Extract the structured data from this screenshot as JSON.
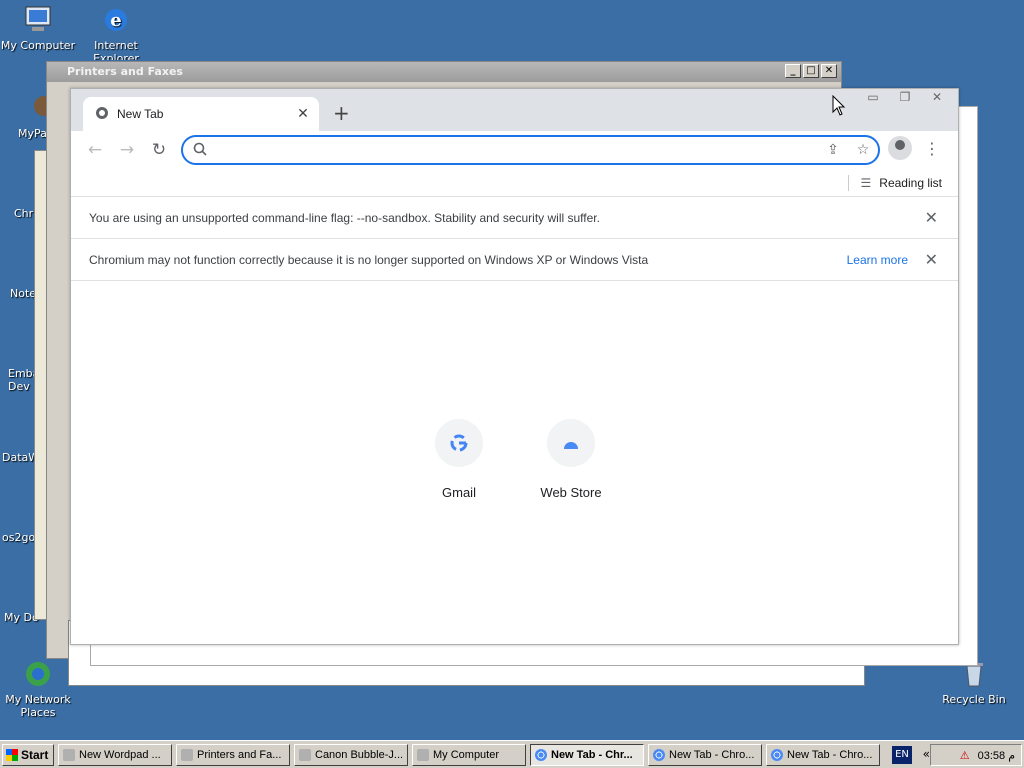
{
  "desktop": {
    "icons": [
      {
        "label": "My Computer"
      },
      {
        "label": "Internet Explorer"
      },
      {
        "label": "MyPal"
      },
      {
        "label": "Chr"
      },
      {
        "label": "Note"
      },
      {
        "label": "Emba Dev"
      },
      {
        "label": "DataW"
      },
      {
        "label": "os2go"
      },
      {
        "label": "My Do"
      },
      {
        "label": "My Network Places"
      },
      {
        "label": "Recycle Bin"
      }
    ]
  },
  "printers_window": {
    "title": "Printers and Faxes"
  },
  "browser": {
    "tab_title": "New Tab",
    "reading_list": "Reading list",
    "omnibox_placeholder": "",
    "infobars": [
      {
        "text": "You are using an unsupported command-line flag: --no-sandbox. Stability and security will suffer."
      },
      {
        "text": "Chromium may not function correctly because it is no longer supported on Windows XP or Windows Vista",
        "link": "Learn more"
      }
    ],
    "shortcuts": [
      {
        "label": "Gmail"
      },
      {
        "label": "Web Store"
      }
    ],
    "colors": {
      "accent": "#1a73e8",
      "tabstrip": "#dee1e6"
    }
  },
  "taskbar": {
    "start": "Start",
    "buttons": [
      {
        "label": "New Wordpad ..."
      },
      {
        "label": "Printers and Fa..."
      },
      {
        "label": "Canon Bubble-J..."
      },
      {
        "label": "My Computer"
      },
      {
        "label": "New Tab - Chr..."
      },
      {
        "label": "New Tab - Chro..."
      },
      {
        "label": "New Tab - Chro..."
      }
    ],
    "lang": "EN",
    "clock": "03:58 م"
  }
}
